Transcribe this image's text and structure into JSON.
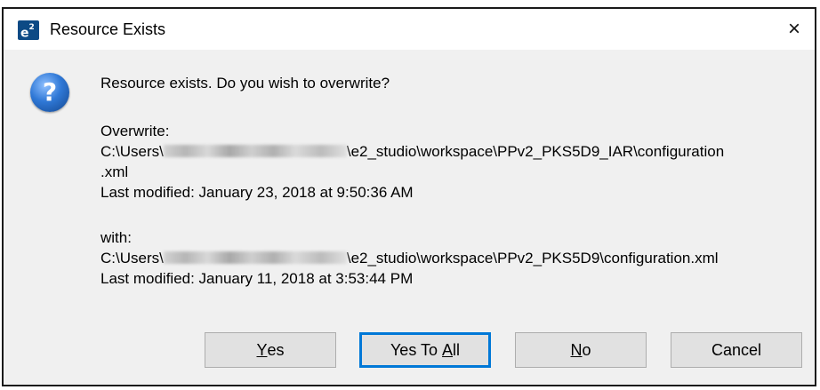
{
  "dialog": {
    "title": "Resource Exists",
    "app_icon_text": "e",
    "app_icon_sup": "2",
    "close_glyph": "×",
    "icon": "question-icon",
    "message": "Resource exists. Do you wish to overwrite?",
    "overwrite": {
      "label": "Overwrite:",
      "path_prefix": "C:\\Users\\",
      "path_suffix": "\\e2_studio\\workspace\\PPv2_PKS5D9_IAR\\configuration",
      "path_wrap": ".xml",
      "last_modified": "Last modified: January 23, 2018 at 9:50:36 AM"
    },
    "with": {
      "label": "with:",
      "path_prefix": "C:\\Users\\",
      "path_suffix": "\\e2_studio\\workspace\\PPv2_PKS5D9\\configuration.xml",
      "last_modified": "Last modified: January 11, 2018 at 3:53:44 PM"
    },
    "buttons": {
      "yes": {
        "mnemonic": "Y",
        "rest": "es"
      },
      "yes_to_all": {
        "before": "Yes To ",
        "mnemonic": "A",
        "after": "ll"
      },
      "no": {
        "mnemonic": "N",
        "rest": "o"
      },
      "cancel": {
        "label": "Cancel"
      }
    }
  },
  "colors": {
    "accent": "#0078d7",
    "dialog_bg": "#f0f0f0",
    "button_bg": "#e1e1e1"
  }
}
